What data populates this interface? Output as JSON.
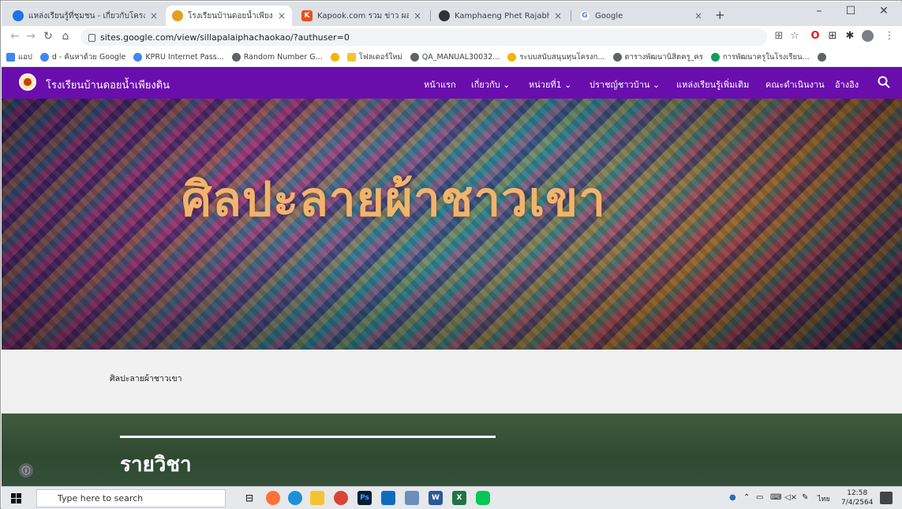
{
  "browser": {
    "tabs": [
      {
        "title": "แหล่งเรียนรู้ที่ชุมชน - เกี่ยวกับโครงการ",
        "favicon_color": "#1a73e8",
        "active": false
      },
      {
        "title": "โรงเรียนบ้านดอยน้ำเพียงดิน",
        "favicon_color": "#e0a020",
        "active": true
      },
      {
        "title": "Kapook.com รวม ข่าว ผลบอล ดารา",
        "favicon_color": "#e8501e",
        "active": false
      },
      {
        "title": "Kamphaeng Phet Rajabhat Unive",
        "favicon_color": "#333333",
        "active": false
      },
      {
        "title": "Google",
        "favicon_color": "#4285f4",
        "active": false
      }
    ],
    "new_tab_label": "+",
    "url": "sites.google.com/view/sillapalaiphachaokao/?authuser=0",
    "bookmarks": [
      {
        "label": "แอป",
        "color": "#4285f4"
      },
      {
        "label": "d - ค้นหาด้วย Google",
        "color": "#4285f4"
      },
      {
        "label": "KPRU Internet Pass...",
        "color": "#4285f4"
      },
      {
        "label": "Random Number G...",
        "color": "#5f6368"
      },
      {
        "label": "",
        "color": "#f4b400"
      },
      {
        "label": "โฟลเดอร์ใหม่",
        "color": "#f4c430"
      },
      {
        "label": "QA_MANUAL30032...",
        "color": "#5f6368"
      },
      {
        "label": "ระบบสนับสนุนทุนโครงก...",
        "color": "#f4b400"
      },
      {
        "label": "ตารางพัฒนานิสิตครู_คร",
        "color": "#5f6368"
      },
      {
        "label": "การพัฒนาครูในโรงเรียน...",
        "color": "#0f9d58"
      },
      {
        "label": "",
        "color": "#5f6368"
      }
    ]
  },
  "site": {
    "name": "โรงเรียนบ้านดอยน้ำเพียงดิน",
    "nav": [
      {
        "label": "หน้าแรก",
        "active": true
      },
      {
        "label": "เกี่ยวกับ ⌄",
        "active": false
      },
      {
        "label": "หน่วยที่1 ⌄",
        "active": false
      },
      {
        "label": "ปราชญ์ชาวบ้าน ⌄",
        "active": false
      },
      {
        "label": "แหล่งเรียนรู้เพิ่มเติม",
        "active": false
      },
      {
        "label": "คณะดำเนินงาน",
        "active": false
      },
      {
        "label": "อ้างอิง",
        "active": false
      }
    ],
    "hero_title": "ศิลปะลายผ้าชาวเขา",
    "breadcrumb": "ศิลปะลายผ้าชาวเขา",
    "section_title": "รายวิชา",
    "brand_color": "#6a0dad"
  },
  "taskbar": {
    "search_placeholder": "Type here to search",
    "lang": "ไทย",
    "time": "12:58",
    "date": "7/4/2564"
  }
}
